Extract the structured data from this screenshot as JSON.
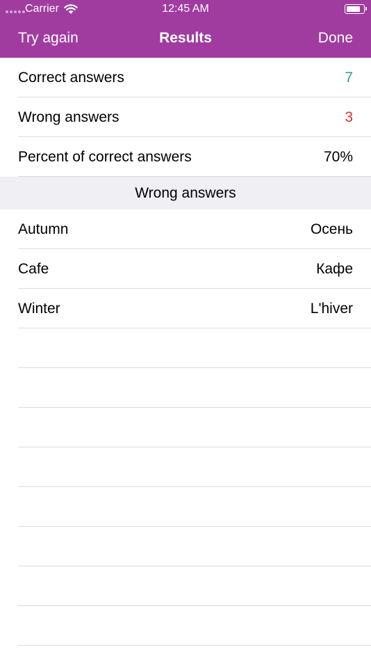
{
  "status_bar": {
    "carrier": "Carrier",
    "time": "12:45 AM",
    "battery_level": 0.85
  },
  "nav": {
    "left_button": "Try again",
    "title": "Results",
    "right_button": "Done"
  },
  "summary": [
    {
      "label": "Correct answers",
      "value": "7",
      "color": "#2aa198"
    },
    {
      "label": "Wrong answers",
      "value": "3",
      "color": "#d0332a"
    },
    {
      "label": "Percent of correct answers",
      "value": "70%",
      "color": "#000000"
    }
  ],
  "wrong_section": {
    "title": "Wrong answers",
    "items": [
      {
        "word": "Autumn",
        "translation": "Осень"
      },
      {
        "word": "Cafe",
        "translation": "Кафе"
      },
      {
        "word": "Winter",
        "translation": "L'hiver"
      }
    ]
  },
  "colors": {
    "nav_bar": "#a03c9f",
    "section_bg": "#efeff4",
    "separator": "#dcdce0"
  }
}
